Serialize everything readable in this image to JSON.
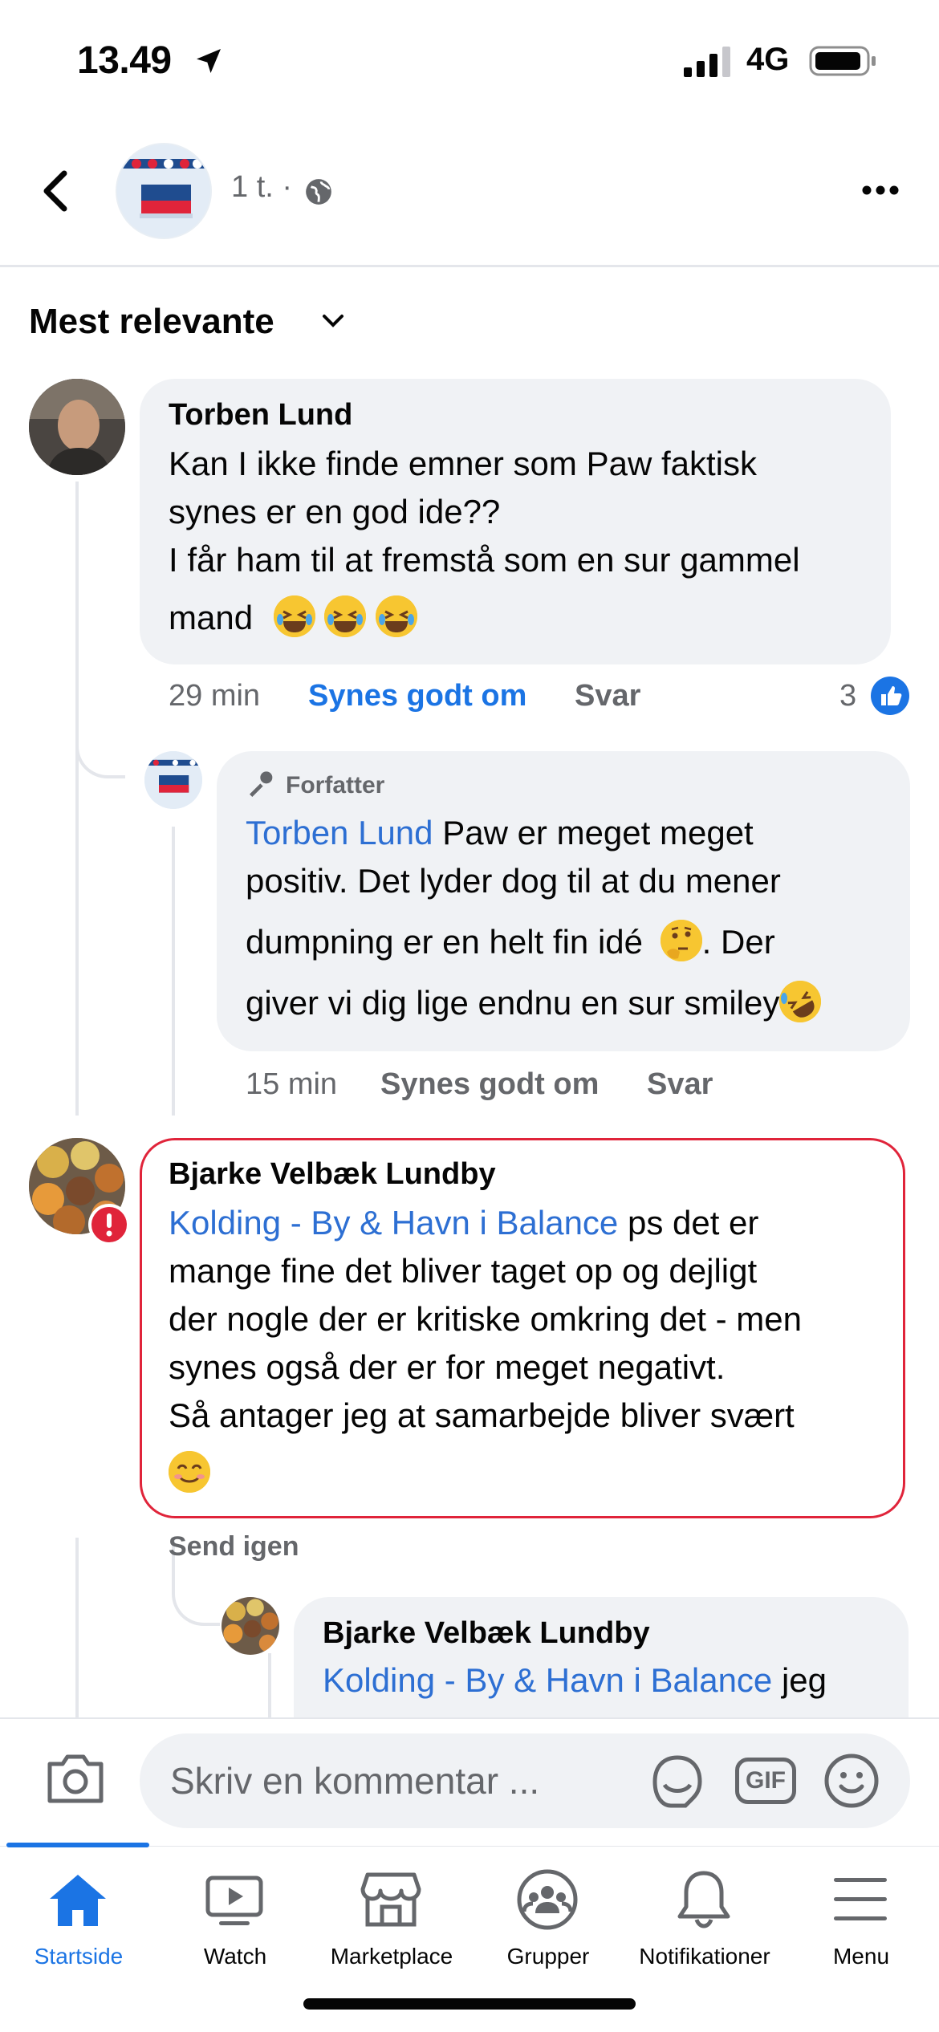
{
  "status_bar": {
    "time": "13.49",
    "network": "4G"
  },
  "header": {
    "meta": "1 t. ·"
  },
  "sort": {
    "label": "Mest relevante"
  },
  "comments": [
    {
      "author": "Torben Lund",
      "lines": [
        "Kan I ikke finde emner som Paw faktisk",
        "synes er en god ide??",
        "I får ham til at fremstå som en sur gammel",
        "mand"
      ],
      "time": "29 min",
      "like_label": "Synes godt om",
      "reply_label": "Svar",
      "reaction_count": "3"
    },
    {
      "badge": "Forfatter",
      "mention": "Torben Lund",
      "line1_rest": " Paw er meget meget",
      "lines": [
        "positiv. Det lyder dog til at du mener",
        "dumpning er en helt fin idé",
        ". Der",
        "giver vi dig lige endnu en sur smiley"
      ],
      "time": "15 min",
      "like_label": "Synes godt om",
      "reply_label": "Svar"
    },
    {
      "author": "Bjarke Velbæk Lundby",
      "mention": "Kolding - By & Havn i Balance",
      "line1_rest": " ps det er",
      "lines": [
        "mange fine det bliver taget op og dejligt",
        "der nogle der er kritiske omkring det - men",
        "synes også der er for meget negativt.",
        "Så antager jeg at samarbejde bliver svært"
      ],
      "resend_label": "Send igen"
    },
    {
      "author": "Bjarke Velbæk Lundby",
      "mention": "Kolding - By & Havn i Balance",
      "line1_rest": " jeg"
    }
  ],
  "composer": {
    "placeholder": "Skriv en kommentar ...",
    "gif_label": "GIF"
  },
  "tabs": [
    {
      "label": "Startside",
      "icon": "home-icon",
      "active": true
    },
    {
      "label": "Watch",
      "icon": "watch-icon"
    },
    {
      "label": "Marketplace",
      "icon": "marketplace-icon"
    },
    {
      "label": "Grupper",
      "icon": "groups-icon"
    },
    {
      "label": "Notifikationer",
      "icon": "bell-icon"
    },
    {
      "label": "Menu",
      "icon": "menu-icon"
    }
  ],
  "colors": {
    "accent": "#1b74e4",
    "mention": "#2d6fd3",
    "error": "#e0243a",
    "bubble": "#f0f2f5"
  }
}
